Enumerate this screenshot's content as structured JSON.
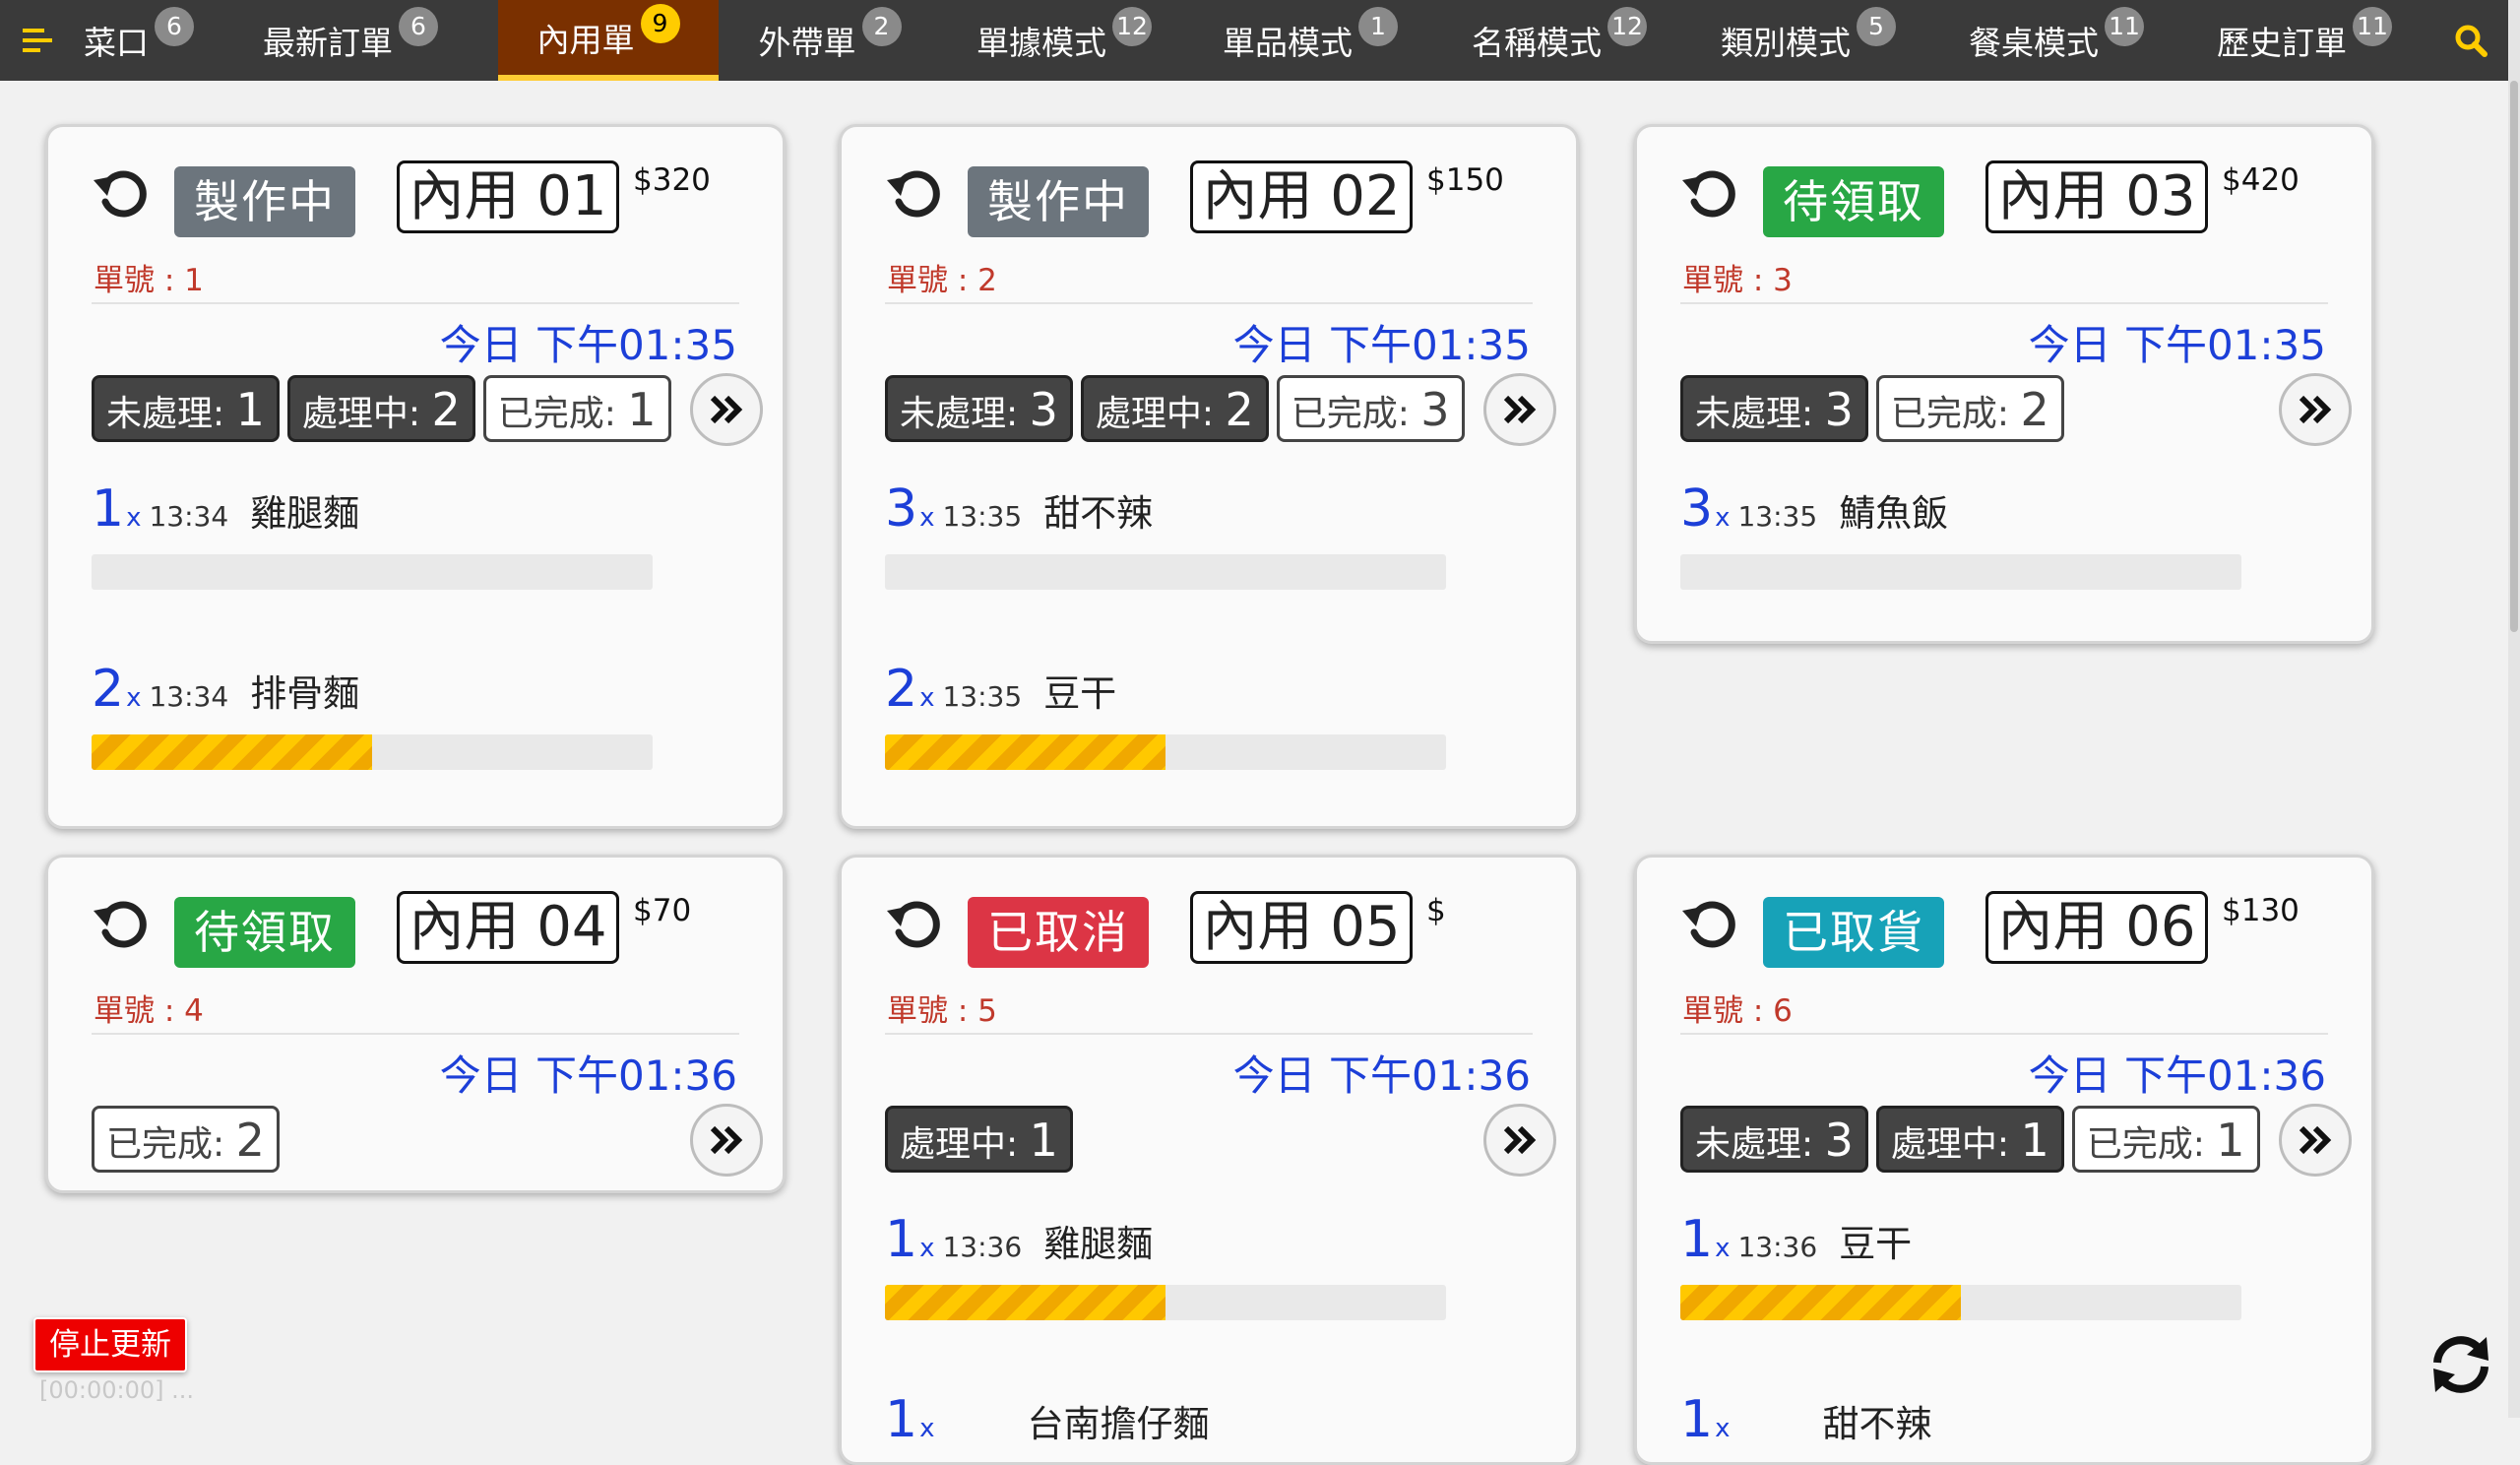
{
  "nav": {
    "tabs": [
      {
        "label": "菜口",
        "count": "6"
      },
      {
        "label": "最新訂單",
        "count": "6"
      },
      {
        "label": "內用單",
        "count": "9",
        "active": true
      },
      {
        "label": "外帶單",
        "count": "2"
      },
      {
        "label": "單據模式",
        "count": "12"
      },
      {
        "label": "單品模式",
        "count": "1"
      },
      {
        "label": "名稱模式",
        "count": "12"
      },
      {
        "label": "類別模式",
        "count": "5"
      },
      {
        "label": "餐桌模式",
        "count": "11"
      },
      {
        "label": "歷史訂單",
        "count": "11"
      }
    ]
  },
  "labels": {
    "pending": "未處理: ",
    "processing": "處理中: ",
    "done": "已完成: "
  },
  "orders": [
    {
      "status": "製作中",
      "status_color": "#6c757d",
      "table": "內用 01",
      "price": "$320",
      "order_no": "單號 : 1",
      "time": "今日 下午01:35",
      "counts": {
        "pending": "1",
        "processing": "2",
        "done": "1"
      },
      "items": [
        {
          "qty": "1",
          "time": "13:34",
          "name": "雞腿麵",
          "progress": 0
        },
        {
          "qty": "2",
          "time": "13:34",
          "name": "排骨麵",
          "progress": 50
        }
      ]
    },
    {
      "status": "製作中",
      "status_color": "#6c757d",
      "table": "內用 02",
      "price": "$150",
      "order_no": "單號 : 2",
      "time": "今日 下午01:35",
      "counts": {
        "pending": "3",
        "processing": "2",
        "done": "3"
      },
      "items": [
        {
          "qty": "3",
          "time": "13:35",
          "name": "甜不辣",
          "progress": 0
        },
        {
          "qty": "2",
          "time": "13:35",
          "name": "豆干",
          "progress": 50
        }
      ]
    },
    {
      "status": "待領取",
      "status_color": "#28a745",
      "table": "內用 03",
      "price": "$420",
      "order_no": "單號 : 3",
      "time": "今日 下午01:35",
      "counts": {
        "pending": "3",
        "done": "2"
      },
      "items": [
        {
          "qty": "3",
          "time": "13:35",
          "name": "鯖魚飯",
          "progress": 0
        }
      ]
    },
    {
      "status": "待領取",
      "status_color": "#28a745",
      "table": "內用 04",
      "price": "$70",
      "order_no": "單號 : 4",
      "time": "今日 下午01:36",
      "counts": {
        "done": "2"
      },
      "items": []
    },
    {
      "status": "已取消",
      "status_color": "#dc3545",
      "table": "內用 05",
      "price": "$",
      "order_no": "單號 : 5",
      "time": "今日 下午01:36",
      "counts": {
        "processing": "1"
      },
      "items": [
        {
          "qty": "1",
          "time": "13:36",
          "name": "雞腿麵",
          "progress": 50
        },
        {
          "qty": "1",
          "time": "",
          "name": "台南擔仔麵",
          "progress": 0
        }
      ]
    },
    {
      "status": "已取貨",
      "status_color": "#17a2b8",
      "table": "內用 06",
      "price": "$130",
      "order_no": "單號 : 6",
      "time": "今日 下午01:36",
      "counts": {
        "pending": "3",
        "processing": "1",
        "done": "1"
      },
      "items": [
        {
          "qty": "1",
          "time": "13:36",
          "name": "豆干",
          "progress": 50
        },
        {
          "qty": "1",
          "time": "",
          "name": "甜不辣",
          "progress": 0
        }
      ]
    }
  ],
  "footer": {
    "stop_label": "停止更新",
    "status_text": "[00:00:00] ..."
  },
  "colors": {
    "nav_bg": "#3a3a3a",
    "active_tab": "#7a3000",
    "accent_yellow": "#ffcc00",
    "time_blue": "#1c3fd8"
  }
}
